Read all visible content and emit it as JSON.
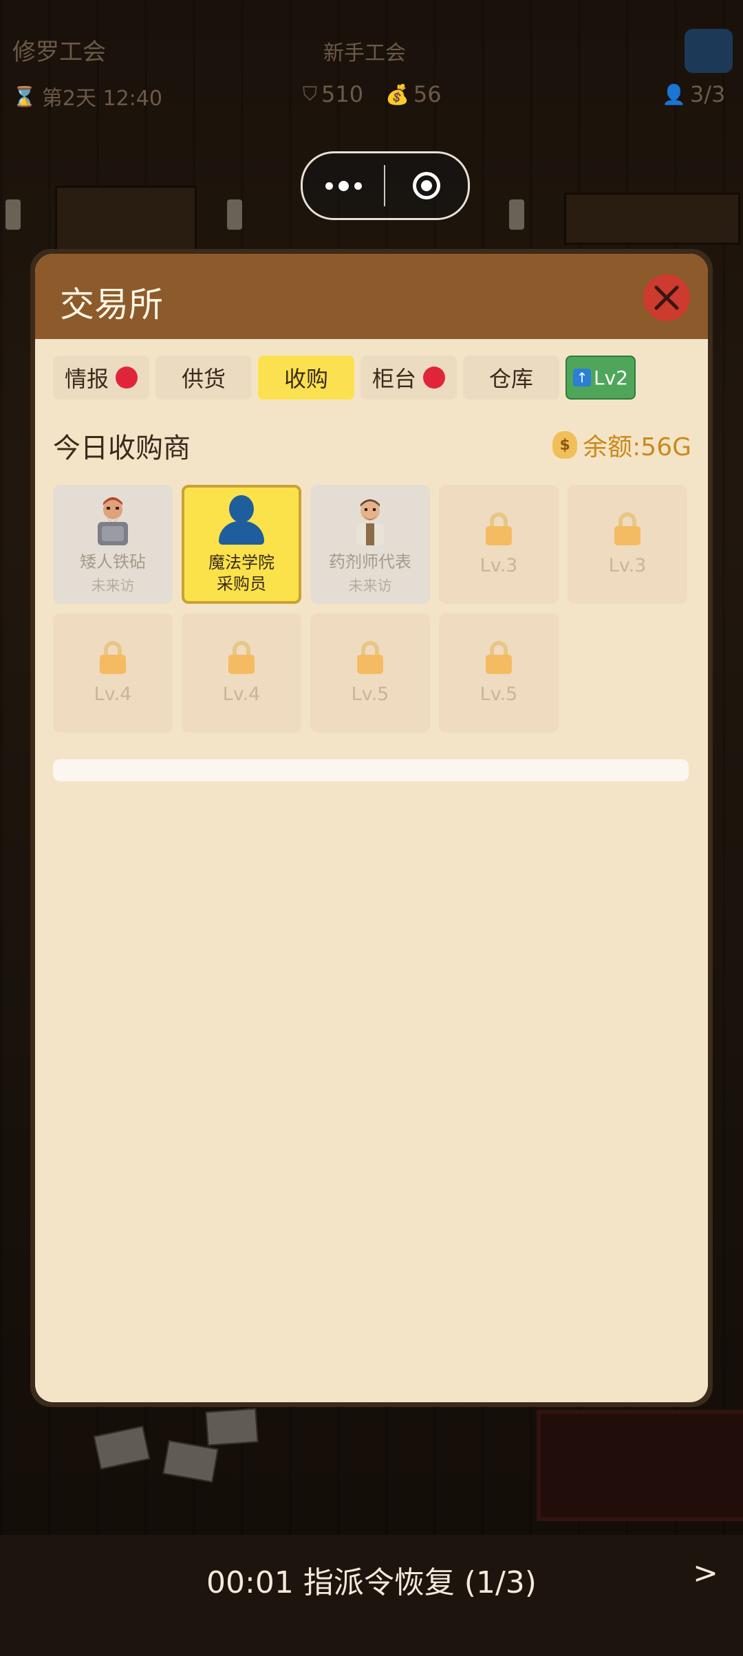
{
  "hud": {
    "guild_name": "修罗工会",
    "guild_rank": "新手工会",
    "day_time": "第2天 12:40",
    "shield_value": "510",
    "money_value": "56",
    "team_count": "3/3",
    "icons": [
      "hourglass-icon",
      "shield-icon",
      "money-bag-icon",
      "person-icon"
    ]
  },
  "modal": {
    "title": "交易所",
    "tabs": [
      {
        "label": "情报",
        "badge": true
      },
      {
        "label": "供货",
        "badge": false
      },
      {
        "label": "收购",
        "badge": false,
        "active": true
      },
      {
        "label": "柜台",
        "badge": true
      },
      {
        "label": "仓库",
        "badge": false
      }
    ],
    "upgrade_label": "Lv2",
    "section_title": "今日收购商",
    "balance": "余额:56G",
    "merchants": [
      {
        "name": "矮人铁砧",
        "status": "未来访",
        "icon": "dwarf-portrait"
      },
      {
        "name": "魔法学院",
        "name2": "采购员",
        "icon": "person-silhouette-icon",
        "selected": true
      },
      {
        "name": "药剂师代表",
        "status": "未来访",
        "icon": "alchemist-portrait"
      }
    ],
    "locked_slots": [
      "Lv.3",
      "Lv.3",
      "Lv.4",
      "Lv.4",
      "Lv.5",
      "Lv.5"
    ]
  },
  "footer": {
    "recovery_text": "00:01 指派令恢复 (1/3)",
    "next": ">"
  },
  "colors": {
    "header": "#8d5a2b",
    "panel": "#f4e4c7",
    "active_tab": "#fbe14f",
    "badge": "#e0253a",
    "upgrade": "#4fa65a",
    "balance": "#c98a1c"
  }
}
